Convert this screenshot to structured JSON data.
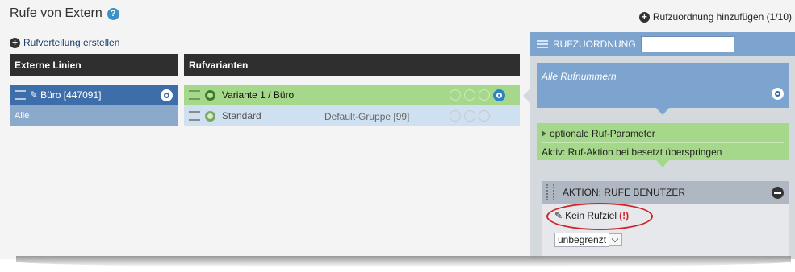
{
  "page": {
    "title": "Rufe von Extern",
    "add_assignment_label": "Rufzuordnung hinzufügen (1/10)"
  },
  "actions": {
    "create_distribution_label": "Rufverteilung erstellen"
  },
  "lines": {
    "header": "Externe Linien",
    "items": [
      {
        "label": "Büro [447091]"
      }
    ],
    "all_label": "Alle"
  },
  "variants": {
    "header": "Rufvarianten",
    "items": [
      {
        "label": "Variante 1 / Büro",
        "group": ""
      },
      {
        "label": "Standard",
        "group": "Default-Gruppe [99]"
      }
    ]
  },
  "assignment": {
    "header": "RUFZUORDNUNG",
    "input_value": "",
    "numbers_label": "Alle Rufnummern",
    "optional_params_label": "optionale Ruf-Parameter",
    "active_text": "Aktiv: Ruf-Aktion bei besetzt überspringen",
    "action_title": "AKTION: RUFE BENUTZER",
    "no_target_label": "Kein Rufziel",
    "no_target_warning": "(!)",
    "duration_value": "unbegrenzt"
  },
  "colors": {
    "accent_blue": "#3e6ea9",
    "active_green": "#a6d88b",
    "panel_blue": "#7ca4cf",
    "warning_red": "#d0232a"
  }
}
